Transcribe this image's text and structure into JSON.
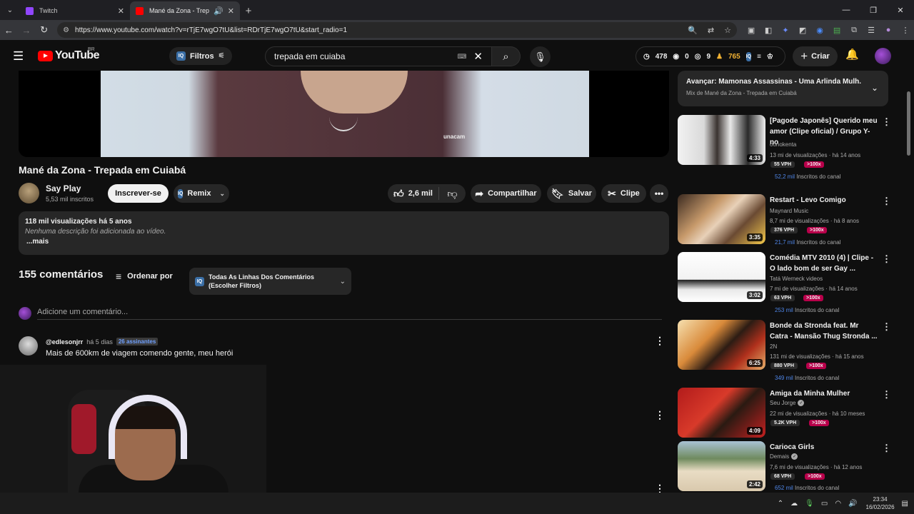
{
  "browser": {
    "tabs": [
      {
        "title": "Twitch",
        "favicon_color": "#9146ff",
        "active": false
      },
      {
        "title": "Mané da Zona - Trepada em ",
        "favicon_color": "#ff0000",
        "active": true
      }
    ],
    "url": "https://www.youtube.com/watch?v=rTjE7wgO7tU&list=RDrTjE7wgO7tU&start_radio=1"
  },
  "masthead": {
    "logo_text": "YouTube",
    "country": "BR",
    "filters_label": "Filtros",
    "search_value": "trepada em cuiaba",
    "stats": {
      "clock": "478",
      "eye": "0",
      "pause": "9",
      "gold": "765"
    },
    "create_label": "Criar"
  },
  "video": {
    "title": "Mané da Zona - Trepada em Cuiabá",
    "watermark": "unacam",
    "channel": "Say Play",
    "subs": "5,53 mil inscritos",
    "subscribe_label": "Inscrever-se",
    "remix_label": "Remix",
    "likes": "2,6 mil",
    "share_label": "Compartilhar",
    "save_label": "Salvar",
    "clip_label": "Clipe",
    "desc_meta": "118 mil visualizações  há 5 anos",
    "desc_text": "Nenhuma descrição foi adicionada ao vídeo.",
    "desc_more": "...mais"
  },
  "comments": {
    "count_label": "155 comentários",
    "sort_label": "Ordenar por",
    "filter_label": "Todas As Linhas Dos Comentários (Escolher Filtros)",
    "add_placeholder": "Adicione um comentário...",
    "items": [
      {
        "author": "@edlesonjrr",
        "ago": "há 5 dias",
        "badge": "26 assinantes",
        "text": "Mais de 600km de viagem comendo gente, meu herói"
      }
    ]
  },
  "sidebar": {
    "queue_title": "Avançar: Mamonas Assassinas - Uma Arlinda Mulh...",
    "queue_sub": "Mix de Mané da Zona - Trepada em Cuiabá",
    "items": [
      {
        "title": "[Pagode Japonês] Querido meu amor (Clipe oficial) / Grupo Y-no",
        "channel": "oonokenta",
        "verified": false,
        "meta": "13 mi de visualizações · há 14 anos",
        "vph": "55 VPH",
        "x": ">100x",
        "insc_n": "52,2 mil",
        "insc": "Inscritos do canal",
        "duration": "4:33",
        "thumb_bg": "linear-gradient(90deg,#f2f2f2 0%,#d9d9d9 30%,#3a3330 45%,#e8e8e8 60%,#2a2a2a 80%,#f0f0f0 100%)"
      },
      {
        "title": "Restart - Levo Comigo",
        "channel": "Maynard Music",
        "verified": false,
        "meta": "8,7 mi de visualizações · há 8 anos",
        "vph": "376 VPH",
        "x": ">100x",
        "insc_n": "21,7 mil",
        "insc": "Inscritos do canal",
        "duration": "3:35",
        "thumb_bg": "linear-gradient(135deg,#3b2a20 0%,#c79a6b 35%,#e8d1b8 50%,#6a4a33 70%,#f3c84a 100%)"
      },
      {
        "title": "Comédia MTV 2010 (4) | Clipe - O lado bom de ser Gay ...",
        "channel": "Tatá Werneck videos",
        "verified": false,
        "meta": "7 mi de visualizações · há 14 anos",
        "vph": "63 VPH",
        "x": ">100x",
        "insc_n": "253 mil",
        "insc": "Inscritos do canal",
        "duration": "3:02",
        "thumb_bg": "linear-gradient(180deg,#ffffff 0%,#f2f2f2 55%,#202020 56%,#e8e8e8 75%,#ffffff 100%)"
      },
      {
        "title": "Bonde da Stronda feat. Mr Catra - Mansão Thug Stronda ...",
        "channel": "2N",
        "verified": false,
        "meta": "131 mi de visualizações · há 15 anos",
        "vph": "880 VPH",
        "x": ">100x",
        "insc_n": "349 mil",
        "insc": "Inscritos do canal",
        "duration": "6:25",
        "thumb_bg": "linear-gradient(135deg,#f6e0b0 0%,#d98a3a 35%,#2c1c14 55%,#b0301c 75%,#e6b06a 100%)"
      },
      {
        "title": "Amiga da Minha Mulher",
        "channel": "Seu Jorge",
        "verified": true,
        "meta": "22 mi de visualizações · há 10 meses",
        "vph": "5.2K VPH",
        "x": ">100x",
        "insc_n": "",
        "insc": "",
        "duration": "4:09",
        "thumb_bg": "linear-gradient(135deg,#b21b1b 0%,#d83a2a 40%,#2a1a12 60%,#c42020 100%)"
      },
      {
        "title": "Carioca Girls",
        "channel": "Demais",
        "verified": true,
        "meta": "7,6 mi de visualizações · há 12 anos",
        "vph": "68 VPH",
        "x": ">100x",
        "insc_n": "652 mil",
        "insc": "Inscritos do canal",
        "duration": "2:42",
        "thumb_bg": "linear-gradient(180deg,#a9c2d4 0%,#6f8a5e 35%,#e9dcc4 60%,#d9c9ad 100%)"
      }
    ]
  },
  "taskbar": {
    "time": "23:34",
    "date": "16/02/2026"
  }
}
